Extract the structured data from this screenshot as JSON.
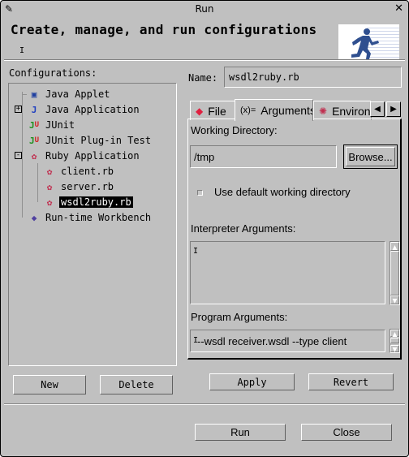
{
  "window": {
    "title": "Run",
    "pin_icon": "pin-icon",
    "close_icon": "close-icon"
  },
  "header": {
    "title": "Create, manage, and run configurations",
    "banner_icon": "running-man-icon"
  },
  "configurations": {
    "label": "Configurations:",
    "items": [
      {
        "label": "Java Applet",
        "icon": "java-applet-icon",
        "level": 0,
        "expander": ""
      },
      {
        "label": "Java Application",
        "icon": "java-application-icon",
        "level": 0,
        "expander": "+"
      },
      {
        "label": "JUnit",
        "icon": "junit-icon",
        "level": 0,
        "expander": ""
      },
      {
        "label": "JUnit Plug-in Test",
        "icon": "junit-plugin-icon",
        "level": 0,
        "expander": ""
      },
      {
        "label": "Ruby Application",
        "icon": "ruby-application-icon",
        "level": 0,
        "expander": "-"
      },
      {
        "label": "client.rb",
        "icon": "ruby-file-icon",
        "level": 1,
        "expander": ""
      },
      {
        "label": "server.rb",
        "icon": "ruby-file-icon",
        "level": 1,
        "expander": ""
      },
      {
        "label": "wsdl2ruby.rb",
        "icon": "ruby-file-icon",
        "level": 1,
        "expander": "",
        "selected": true
      },
      {
        "label": "Run-time Workbench",
        "icon": "workbench-icon",
        "level": 0,
        "expander": ""
      }
    ],
    "new_label": "New",
    "delete_label": "Delete"
  },
  "editor": {
    "name_label": "Name:",
    "name_value": "wsdl2ruby.rb",
    "tabs": [
      {
        "label": "File",
        "icon": "file-icon",
        "active": false
      },
      {
        "label": "Arguments",
        "icon": "arguments-icon",
        "active": true
      },
      {
        "label": "Environment",
        "icon": "environment-icon",
        "active": false
      }
    ],
    "tab_scroll_left": "◀",
    "tab_scroll_right": "▶",
    "working_directory_label": "Working Directory:",
    "working_directory_value": "/tmp",
    "browse_label": "Browse...",
    "use_default_label": "Use default working directory",
    "use_default_checked": false,
    "interpreter_args_label": "Interpreter Arguments:",
    "interpreter_args_value": "",
    "program_args_label": "Program Arguments:",
    "program_args_value": "--wsdl receiver.wsdl --type client",
    "apply_label": "Apply",
    "revert_label": "Revert"
  },
  "footer": {
    "run_label": "Run",
    "close_label": "Close"
  }
}
